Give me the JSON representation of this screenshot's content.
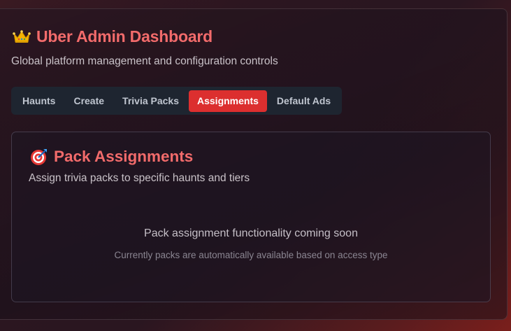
{
  "header": {
    "title": "Uber Admin Dashboard",
    "subtitle": "Global platform management and configuration controls",
    "icon": "crown-icon"
  },
  "tabs": [
    {
      "label": "Haunts",
      "active": false
    },
    {
      "label": "Create",
      "active": false
    },
    {
      "label": "Trivia Packs",
      "active": false
    },
    {
      "label": "Assignments",
      "active": true
    },
    {
      "label": "Default Ads",
      "active": false
    }
  ],
  "card": {
    "icon": "target-icon",
    "title": "Pack Assignments",
    "subtitle": "Assign trivia packs to specific haunts and tiers",
    "message": "Pack assignment functionality coming soon",
    "note": "Currently packs are automatically available based on access type"
  },
  "colors": {
    "accent": "#f26b6b",
    "active_tab": "#dc2f2f",
    "tab_bar": "#1e2530"
  }
}
